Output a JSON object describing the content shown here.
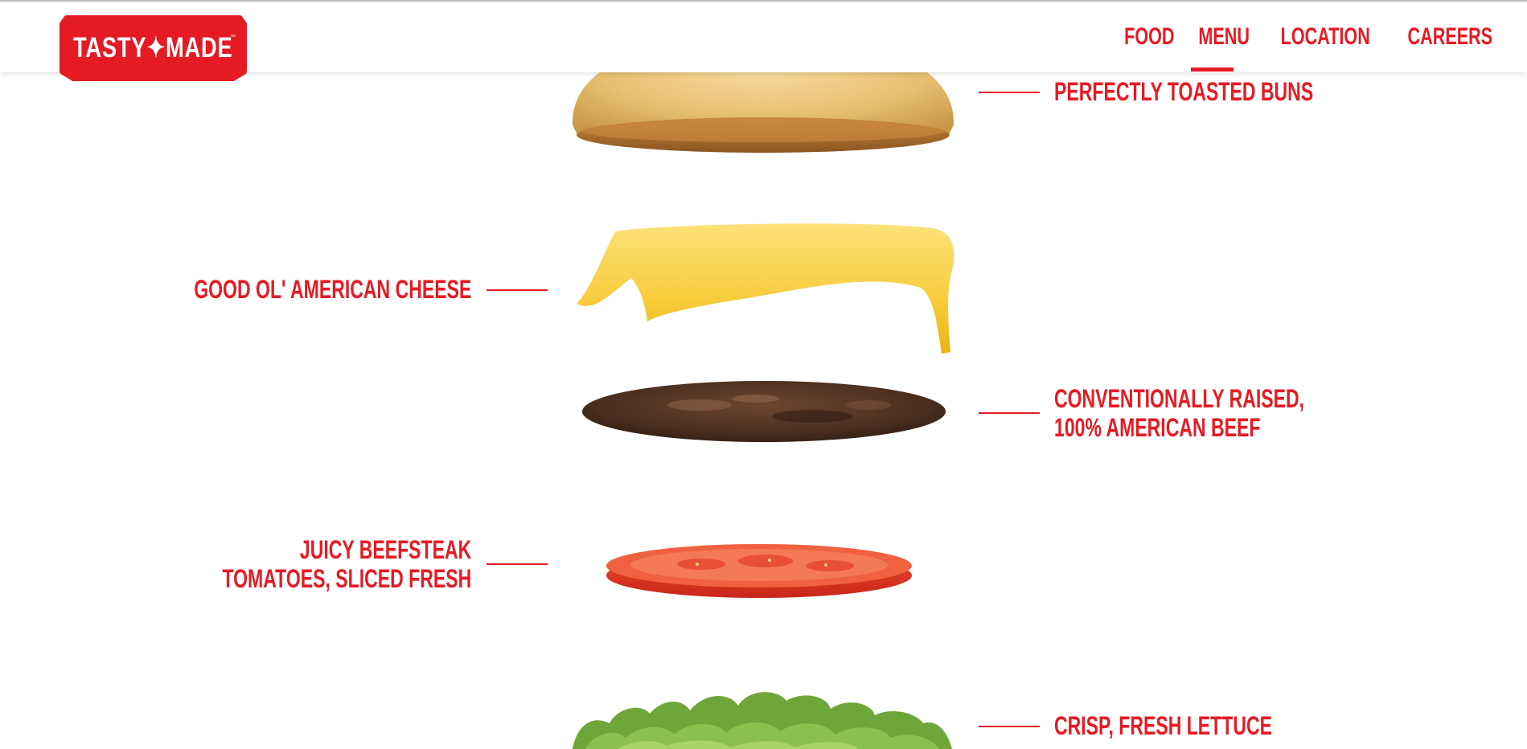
{
  "brand": {
    "logo_text": "TASTY✦MADE",
    "trademark": "™",
    "color": "#e51b24"
  },
  "nav": {
    "items": [
      {
        "label": "FOOD",
        "active": true
      },
      {
        "label": "MENU",
        "active": false
      },
      {
        "label": "LOCATION",
        "active": false
      },
      {
        "label": "CAREERS",
        "active": false
      }
    ]
  },
  "ingredients": [
    {
      "label_line1": "PERFECTLY TOASTED BUNS",
      "label_line2": "",
      "side": "right",
      "image": "bun-image"
    },
    {
      "label_line1": "GOOD OL' AMERICAN CHEESE",
      "label_line2": "",
      "side": "left",
      "image": "cheese-image"
    },
    {
      "label_line1": "CONVENTIONALLY RAISED,",
      "label_line2": "100% AMERICAN BEEF",
      "side": "right",
      "image": "patty-image"
    },
    {
      "label_line1": "JUICY BEEFSTEAK",
      "label_line2": "TOMATOES, SLICED FRESH",
      "side": "left",
      "image": "tomato-image"
    },
    {
      "label_line1": "CRISP, FRESH LETTUCE",
      "label_line2": "",
      "side": "right",
      "image": "lettuce-image"
    }
  ]
}
